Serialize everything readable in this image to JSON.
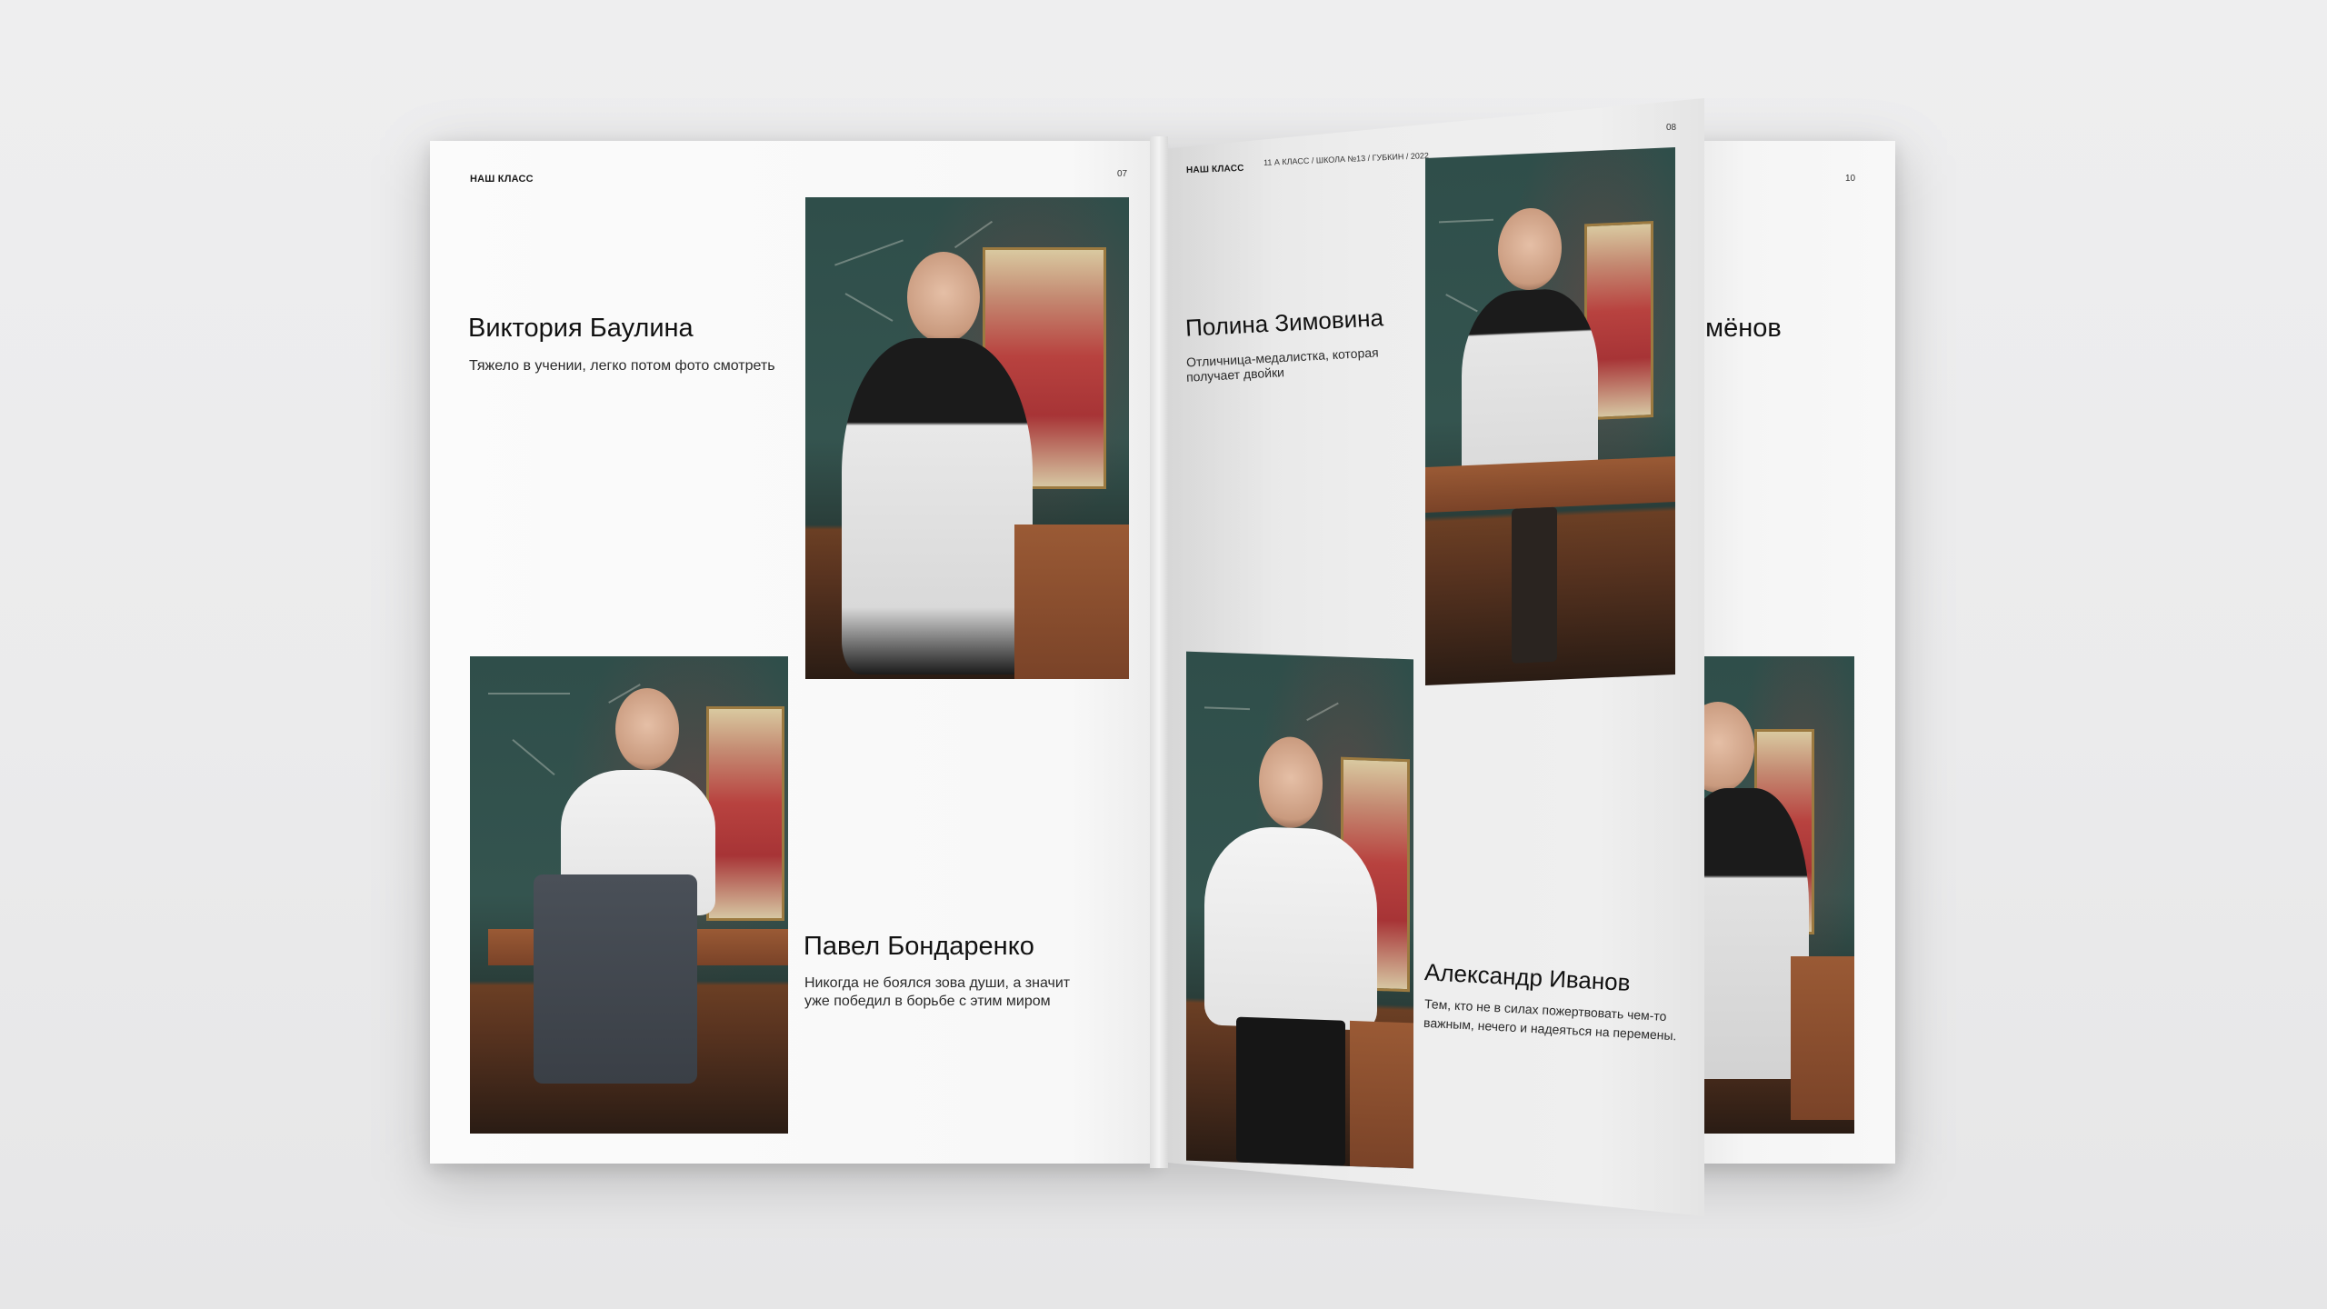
{
  "spread": {
    "left_page": {
      "header": "НАШ КЛАСС",
      "page_number": "07",
      "students": [
        {
          "name": "Виктория Баулина",
          "quote_lines": [
            "Тяжело в учении, легко потом фото смотреть"
          ]
        },
        {
          "name": "Павел Бондаренко",
          "quote_lines": [
            "Никогда не боялся зова души, а значит",
            "уже победил в борьбе с этим миром"
          ]
        }
      ]
    },
    "flip_page": {
      "header": "НАШ КЛАСС",
      "subheader": "11 А КЛАСС / ШКОЛА №13 / ГУБКИН / 2022",
      "page_number": "08",
      "students": [
        {
          "name": "Полина Зимовина",
          "quote_lines": [
            "Отличница-медалистка, которая",
            "получает двойки"
          ]
        },
        {
          "name": "Александр Иванов",
          "quote_lines": [
            "Тем, кто не в силах пожертвовать чем-то",
            "важным, нечего и надеяться на перемены."
          ]
        }
      ]
    },
    "right_page": {
      "page_number": "10",
      "partial_name": "емёнов"
    }
  }
}
